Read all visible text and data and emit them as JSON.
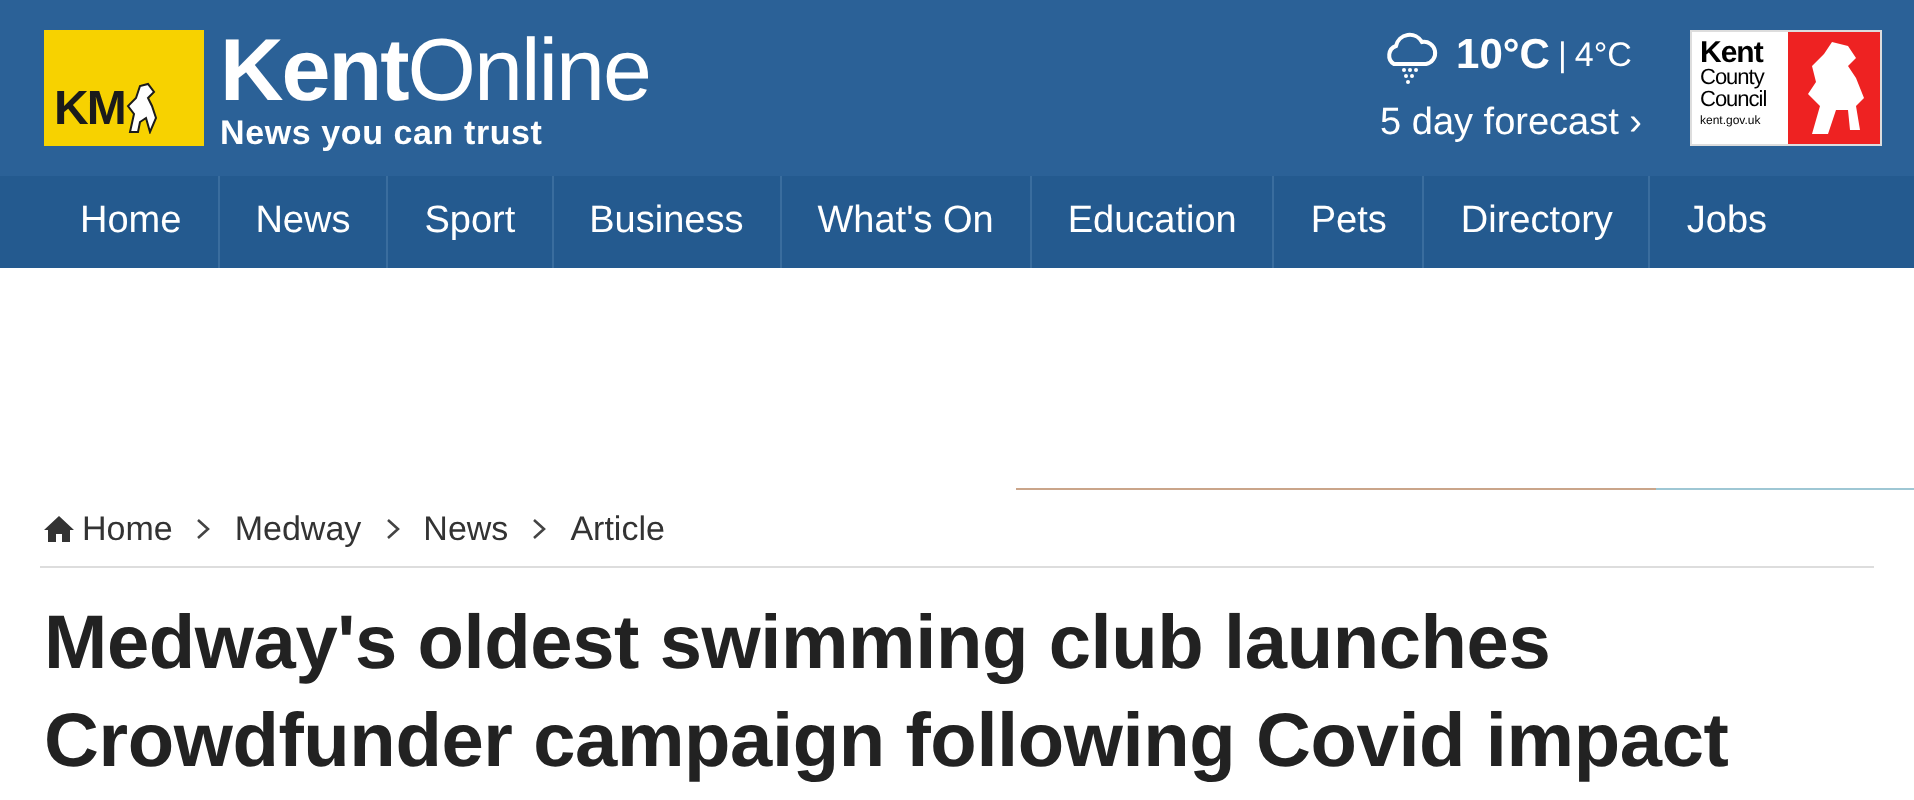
{
  "header": {
    "logo_mark": "KM",
    "site_name_bold": "Kent",
    "site_name_light": "Online",
    "tagline": "News you can trust",
    "weather": {
      "high": "10°C",
      "separator": "|",
      "low": "4°C",
      "forecast_link": "5 day forecast ›"
    },
    "council_logo": {
      "lines": [
        "Kent",
        "County",
        "Council"
      ],
      "url": "kent.gov.uk"
    }
  },
  "nav": [
    {
      "label": "Home"
    },
    {
      "label": "News"
    },
    {
      "label": "Sport"
    },
    {
      "label": "Business"
    },
    {
      "label": "What's On"
    },
    {
      "label": "Education"
    },
    {
      "label": "Pets"
    },
    {
      "label": "Directory"
    },
    {
      "label": "Jobs"
    }
  ],
  "breadcrumb": [
    {
      "label": "Home",
      "kind": "home"
    },
    {
      "label": "Medway",
      "kind": "link"
    },
    {
      "label": "News",
      "kind": "link"
    },
    {
      "label": "Article",
      "kind": "link"
    }
  ],
  "headline": "Medway's oldest swimming club launches Crowdfunder campaign following Covid impact"
}
